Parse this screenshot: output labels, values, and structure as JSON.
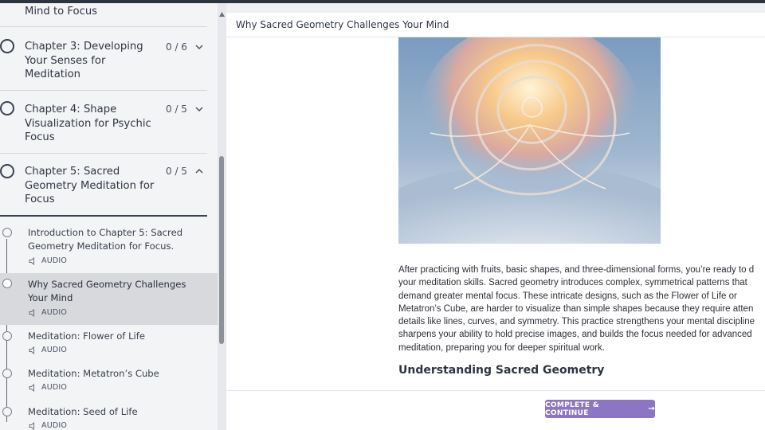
{
  "sidebar": {
    "chapters": [
      {
        "title": "Mind to Focus",
        "progress": "",
        "chevron": "none"
      },
      {
        "title": "Chapter 3: Developing Your Senses for Meditation",
        "progress": "0 / 6",
        "chevron": "chevron-down"
      },
      {
        "title": "Chapter 4: Shape Visualization for Psychic Focus",
        "progress": "0 / 5",
        "chevron": "chevron-down"
      },
      {
        "title": "Chapter 5: Sacred Geometry Meditation for Focus",
        "progress": "0 / 5",
        "chevron": "chevron-up"
      }
    ],
    "lessons": [
      {
        "title": "Introduction to Chapter 5: Sacred Geometry Meditation for Focus.",
        "media": "AUDIO",
        "active": false
      },
      {
        "title": "Why Sacred Geometry Challenges Your Mind",
        "media": "AUDIO",
        "active": true
      },
      {
        "title": "Meditation: Flower of Life",
        "media": "AUDIO",
        "active": false
      },
      {
        "title": "Meditation: Metatron’s Cube",
        "media": "AUDIO",
        "active": false
      },
      {
        "title": "Meditation: Seed of Life",
        "media": "AUDIO",
        "active": false
      }
    ]
  },
  "main": {
    "title": "Why Sacred Geometry Challenges Your Mind",
    "hero_icon": "spiral-shell-image",
    "paragraph": "After practicing with fruits, basic shapes, and three-dimensional forms, you’re ready to d\nyour meditation skills. Sacred geometry introduces complex, symmetrical patterns that\ndemand greater mental focus. These intricate designs, such as the Flower of Life or\nMetatron’s Cube, are harder to visualize than simple shapes because they require atten\ndetails like lines, curves, and symmetry. This practice strengthens your mental discipline\nsharpens your ability to hold precise images, and builds the focus needed for advanced\nmeditation, preparing you for deeper spiritual work.",
    "section_heading": "Understanding Sacred Geometry",
    "cta_label": "COMPLETE & CONTINUE",
    "cta_arrow": "→"
  },
  "colors": {
    "accent": "#8c76c4",
    "sidebar_bg": "#f3f4f6",
    "active_lesson_bg": "#d7d9dd",
    "topbar": "#2c3440"
  }
}
